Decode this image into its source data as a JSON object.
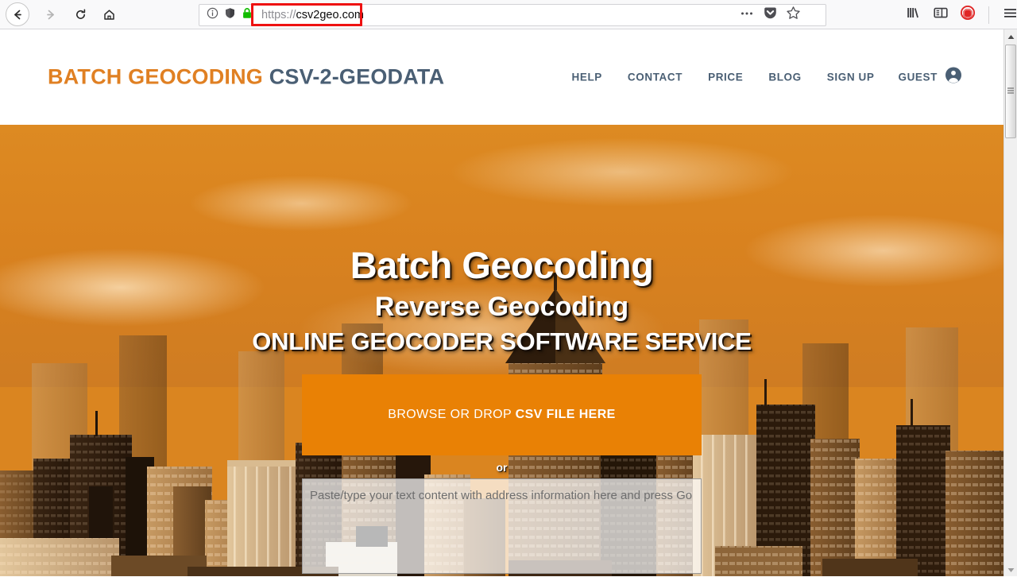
{
  "browser": {
    "back_icon": "arrow-left-icon",
    "forward_icon": "arrow-right-icon",
    "reload_icon": "reload-icon",
    "home_icon": "home-icon",
    "identity_icon": "info-circle-icon",
    "tracking_icon": "shield-icon",
    "lock_icon": "padlock-icon",
    "url_scheme": "https://",
    "url_host": "csv2geo.com",
    "url_full": "https://csv2geo.com",
    "page_actions_icon": "ellipsis-icon",
    "pocket_icon": "pocket-icon",
    "bookmark_icon": "star-icon",
    "library_icon": "library-icon",
    "sidebar_icon": "sidebar-icon",
    "shield_red_icon": "adblock-icon",
    "menu_icon": "hamburger-menu-icon",
    "highlight_color": "#ee1111"
  },
  "scrollbar": {
    "up_icon": "scroll-up-arrow-icon",
    "down_icon": "scroll-down-arrow-icon"
  },
  "site": {
    "logo": {
      "primary": "BATCH GEOCODING",
      "secondary": "CSV-2-GEODATA",
      "primary_color": "#e08023",
      "secondary_color": "#4a5f74"
    },
    "nav": {
      "items": [
        {
          "label": "HELP"
        },
        {
          "label": "CONTACT"
        },
        {
          "label": "PRICE"
        },
        {
          "label": "BLOG"
        },
        {
          "label": "SIGN UP"
        }
      ],
      "account_label": "GUEST",
      "account_icon": "user-account-icon"
    }
  },
  "hero": {
    "title_line1": "Batch Geocoding",
    "title_line2": "Reverse Geocoding",
    "title_line3": "ONLINE GEOCODER SOFTWARE SERVICE",
    "dropzone": {
      "label_regular": "BROWSE OR DROP ",
      "label_bold": "CSV FILE HERE",
      "background_color": "#e98105"
    },
    "separator_label": "or",
    "paste_area": {
      "placeholder": "Paste/type your text content with address information here and press Go",
      "value": ""
    },
    "background_color": "#da8520"
  }
}
